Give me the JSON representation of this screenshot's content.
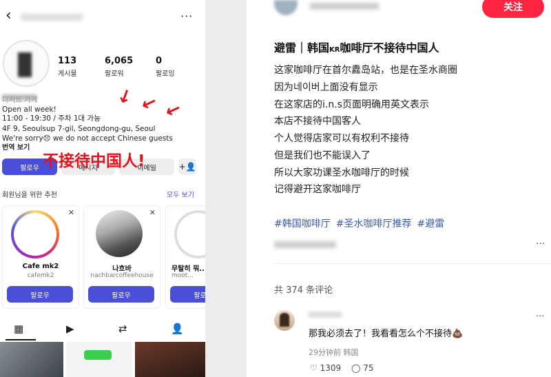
{
  "profile": {
    "nav": {
      "back_icon": "‹",
      "more_icon": "···"
    },
    "stats": [
      {
        "value": "113",
        "label": "게시물"
      },
      {
        "value": "6,065",
        "label": "팔로워"
      },
      {
        "value": "0",
        "label": "팔로잉"
      }
    ],
    "bio": {
      "category": "디저트 가게",
      "open": "Open all week!",
      "hours": "11:00 - 19:30 / 주차 1대 가능",
      "address": "4F 9, Seoulsup 7-gil, Seongdong-gu, Seoul",
      "notice": "We're sorry😞 we do not accept Chinese guests",
      "translate": "번역 보기"
    },
    "annotation": "不接待中国人!",
    "buttons": {
      "follow": "팔로우",
      "message": "메시지",
      "email": "이메일",
      "add_user_icon": "+👤"
    },
    "suggestions": {
      "title": "회원님을 위한 추천",
      "see_all": "모두 보기",
      "cards": [
        {
          "name": "Cafe mk2",
          "handle": "cafemk2",
          "follow": "팔로우"
        },
        {
          "name": "나흐바",
          "handle": "nachbarcoffeehouse",
          "follow": "팔로우"
        },
        {
          "name": "무탈히 뭐...",
          "handle": "moot...",
          "follow": "팔로우"
        }
      ]
    },
    "tabs": {
      "grid_icon": "▦",
      "reels_icon": "▶",
      "tagged_icon": "⇄",
      "person_icon": "👤"
    }
  },
  "note": {
    "follow_button": "关注",
    "title_prefix": "避雷｜韩国",
    "title_kr": "KR",
    "title_suffix": "咖啡厅不接待中国人",
    "body": [
      "这家咖啡厅在首尔纛岛站，也是在圣水商圈",
      "因为네이버上面没有显示",
      "在这家店的i.n.s页面明确用英文表示",
      "本店不接待中国客人",
      "个人觉得店家可以有权利不接待",
      "但是我们也不能误入了",
      "所以大家功课圣水咖啡厅的时候",
      "记得避开这家咖啡厅"
    ],
    "tags": [
      "#韩国咖啡厅",
      "#圣水咖啡厅推荐",
      "#避雷"
    ],
    "comment_count": "共 374 条评论",
    "comment": {
      "text": "那我必须去了！我看看怎么个不接待💩",
      "meta": "29分钟前 韩国",
      "likes": "1309",
      "replies": "75"
    },
    "more_icon": "···"
  },
  "colors": {
    "instagram_blue": "#4a4fd8",
    "xhs_red": "#ff2442",
    "annotation_red": "#e0141e",
    "tag_blue": "#3a5ba8"
  }
}
